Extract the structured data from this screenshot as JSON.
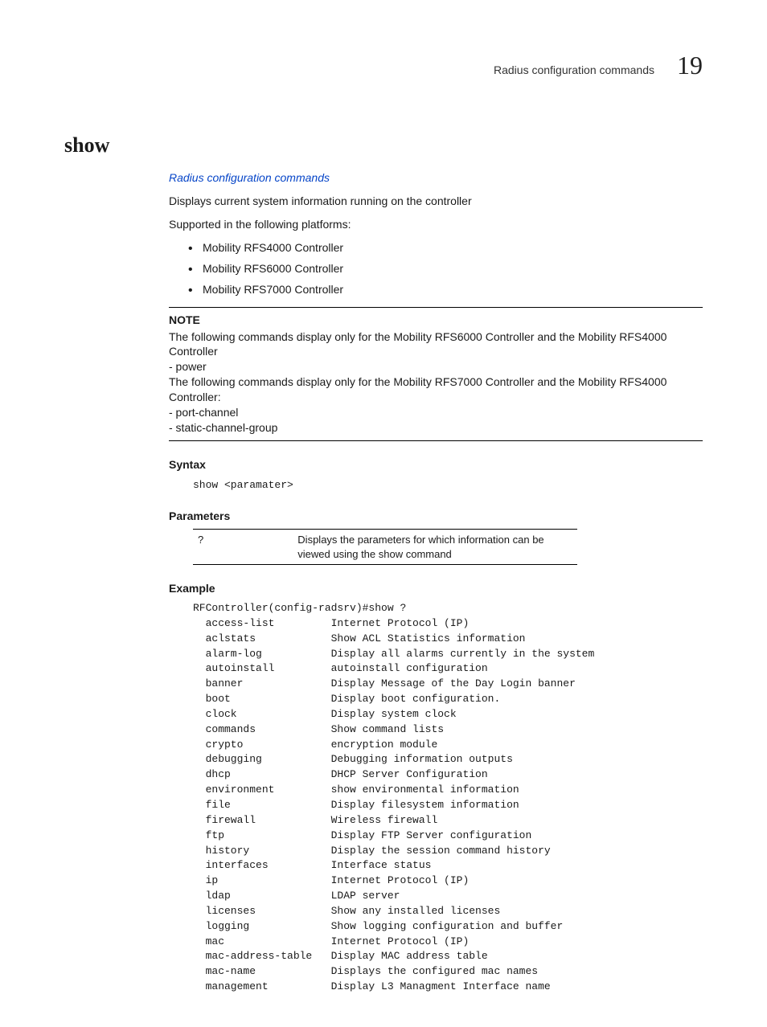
{
  "header": {
    "section_label": "Radius configuration commands",
    "chapter_number": "19"
  },
  "section": {
    "title": "show",
    "xref": "Radius configuration commands",
    "description": "Displays current system information running on the controller",
    "supported_label": "Supported in the following platforms:",
    "platforms": [
      "Mobility RFS4000 Controller",
      "Mobility RFS6000 Controller",
      "Mobility RFS7000 Controller"
    ]
  },
  "note": {
    "label": "NOTE",
    "line1": "The following commands display only for the Mobility RFS6000 Controller and the Mobility RFS4000 Controller",
    "line2": "- power",
    "line3": "The following commands display only for the Mobility RFS7000 Controller and the Mobility RFS4000 Controller:",
    "line4": "- port-channel",
    "line5": "- static-channel-group"
  },
  "syntax": {
    "label": "Syntax",
    "code": "show <paramater>"
  },
  "parameters": {
    "label": "Parameters",
    "rows": [
      {
        "key": "?",
        "desc": "Displays the parameters for which information can be viewed using the show command"
      }
    ]
  },
  "example": {
    "label": "Example",
    "prompt": "RFController(config-radsrv)#show ?",
    "rows": [
      {
        "k": "access-list",
        "d": "Internet Protocol (IP)"
      },
      {
        "k": "aclstats",
        "d": "Show ACL Statistics information"
      },
      {
        "k": "alarm-log",
        "d": "Display all alarms currently in the system"
      },
      {
        "k": "autoinstall",
        "d": "autoinstall configuration"
      },
      {
        "k": "banner",
        "d": "Display Message of the Day Login banner"
      },
      {
        "k": "boot",
        "d": "Display boot configuration."
      },
      {
        "k": "clock",
        "d": "Display system clock"
      },
      {
        "k": "commands",
        "d": "Show command lists"
      },
      {
        "k": "crypto",
        "d": "encryption module"
      },
      {
        "k": "debugging",
        "d": "Debugging information outputs"
      },
      {
        "k": "dhcp",
        "d": "DHCP Server Configuration"
      },
      {
        "k": "environment",
        "d": "show environmental information"
      },
      {
        "k": "file",
        "d": "Display filesystem information"
      },
      {
        "k": "firewall",
        "d": "Wireless firewall"
      },
      {
        "k": "ftp",
        "d": "Display FTP Server configuration"
      },
      {
        "k": "history",
        "d": "Display the session command history"
      },
      {
        "k": "interfaces",
        "d": "Interface status"
      },
      {
        "k": "ip",
        "d": "Internet Protocol (IP)"
      },
      {
        "k": "ldap",
        "d": "LDAP server"
      },
      {
        "k": "licenses",
        "d": "Show any installed licenses"
      },
      {
        "k": "logging",
        "d": "Show logging configuration and buffer"
      },
      {
        "k": "mac",
        "d": "Internet Protocol (IP)"
      },
      {
        "k": "mac-address-table",
        "d": "Display MAC address table"
      },
      {
        "k": "mac-name",
        "d": "Displays the configured mac names"
      },
      {
        "k": "management",
        "d": "Display L3 Managment Interface name"
      }
    ]
  }
}
